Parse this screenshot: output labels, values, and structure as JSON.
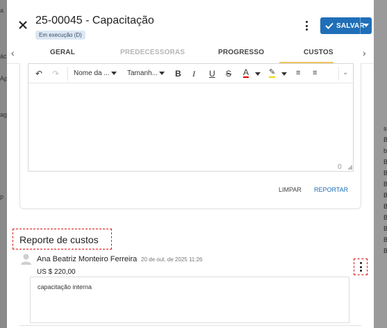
{
  "header": {
    "title": "25-00045 - Capacitação",
    "status": "Em execução (D)",
    "save_label": "SALVAR"
  },
  "tabs": [
    {
      "label": "GERAL",
      "active": false,
      "disabled": false
    },
    {
      "label": "PREDECESSORAS",
      "active": false,
      "disabled": true
    },
    {
      "label": "PROGRESSO",
      "active": false,
      "disabled": false
    },
    {
      "label": "CUSTOS",
      "active": true,
      "disabled": false
    }
  ],
  "editor": {
    "font_name": "Nome da ...",
    "font_size": "Tamanh...",
    "char_count": "0"
  },
  "actions": {
    "clear": "LIMPAR",
    "report": "REPORTAR"
  },
  "section": {
    "title": "Reporte de custos"
  },
  "report": {
    "author": "Ana Beatriz Monteiro Ferreira",
    "date": "20 de out. de 2025 11:26",
    "amount": "US $ 220,00",
    "comment": "capacitação interna"
  },
  "background_fragments": {
    "left": [
      "a",
      "ác",
      "Ap",
      "ag",
      "p"
    ],
    "right": [
      "sp",
      "B",
      "bc",
      "B",
      "B",
      "B",
      "B",
      "B",
      "B",
      "B",
      "B",
      "B"
    ]
  },
  "colors": {
    "primary": "#1f6fb8",
    "tab_underline": "#f0c560",
    "highlight_border": "#dd1111",
    "badge_bg": "#dbe7f4"
  }
}
